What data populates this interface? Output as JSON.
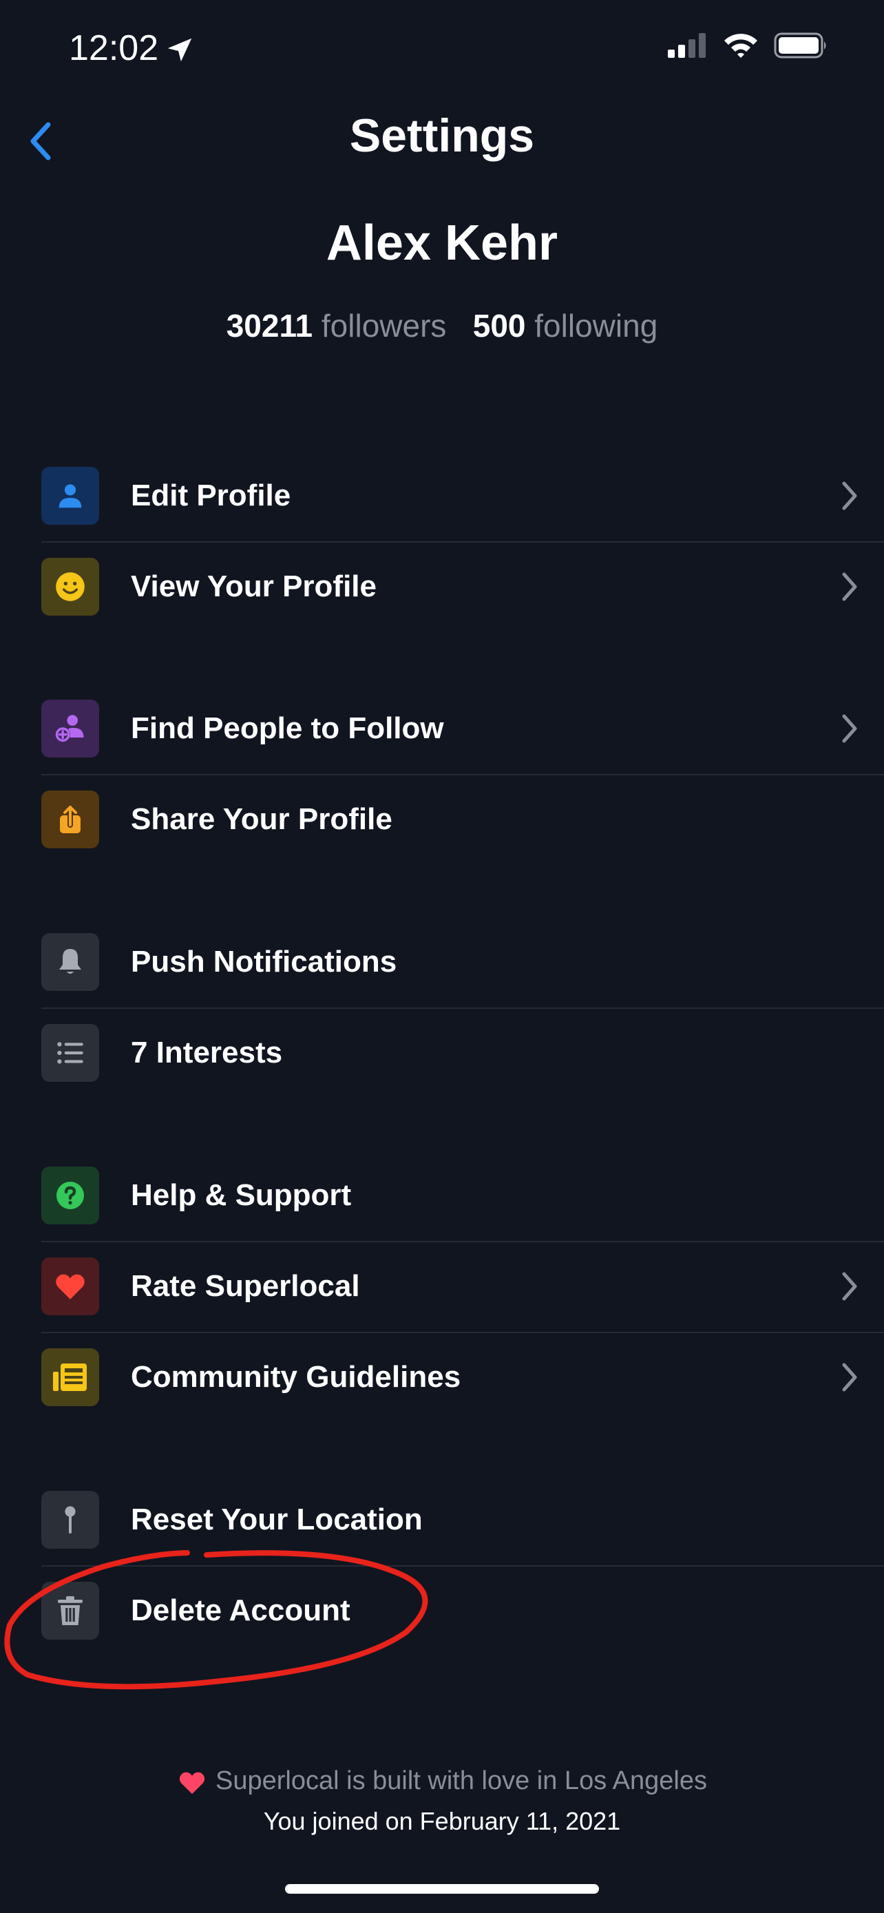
{
  "status": {
    "time": "12:02"
  },
  "header": {
    "title": "Settings"
  },
  "profile": {
    "name": "Alex Kehr",
    "followers_count": "30211",
    "followers_label": "followers",
    "following_count": "500",
    "following_label": "following"
  },
  "groups": [
    [
      {
        "label": "Edit Profile",
        "icon": "person-icon",
        "icon_bg": "#12305e",
        "icon_color": "#2d8cf0",
        "chevron": true
      },
      {
        "label": "View Your Profile",
        "icon": "smiley-icon",
        "icon_bg": "#4b4318",
        "icon_color": "#f5c518",
        "chevron": true
      }
    ],
    [
      {
        "label": "Find People to Follow",
        "icon": "add-person-icon",
        "icon_bg": "#3e2557",
        "icon_color": "#b468f0",
        "chevron": true
      },
      {
        "label": "Share Your Profile",
        "icon": "share-icon",
        "icon_bg": "#533811",
        "icon_color": "#f5a524",
        "chevron": false
      }
    ],
    [
      {
        "label": "Push Notifications",
        "icon": "bell-icon",
        "icon_bg": "#2b2f38",
        "icon_color": "#a7abb3",
        "chevron": false
      },
      {
        "label": "7 Interests",
        "icon": "list-icon",
        "icon_bg": "#2b2f38",
        "icon_color": "#a7abb3",
        "chevron": false
      }
    ],
    [
      {
        "label": "Help & Support",
        "icon": "question-icon",
        "icon_bg": "#183d26",
        "icon_color": "#34c759",
        "chevron": false
      },
      {
        "label": "Rate Superlocal",
        "icon": "heart-icon",
        "icon_bg": "#4e1c20",
        "icon_color": "#ff453a",
        "chevron": true
      },
      {
        "label": "Community Guidelines",
        "icon": "newspaper-icon",
        "icon_bg": "#4b4318",
        "icon_color": "#f5c518",
        "chevron": true
      }
    ],
    [
      {
        "label": "Reset Your Location",
        "icon": "pin-icon",
        "icon_bg": "#2b2f38",
        "icon_color": "#a7abb3",
        "chevron": false
      },
      {
        "label": "Delete Account",
        "icon": "trash-icon",
        "icon_bg": "#2b2f38",
        "icon_color": "#a7abb3",
        "chevron": false
      }
    ]
  ],
  "footer": {
    "love_text": "Superlocal is built with love in Los Angeles",
    "joined_text": "You joined on February 11, 2021"
  },
  "colors": {
    "background": "#111520",
    "accent": "#2d8cf0",
    "annotation": "#e8231b"
  }
}
